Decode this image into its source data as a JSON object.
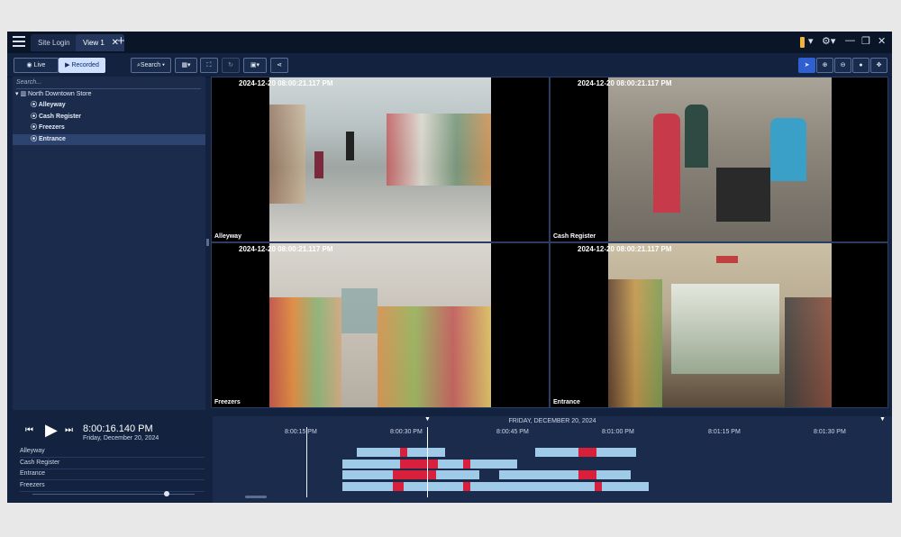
{
  "titlebar": {
    "tabs": [
      "Site Login",
      "View 1"
    ],
    "new_tab": "+"
  },
  "toolbar": {
    "live_label": "Live",
    "recorded_label": "Recorded",
    "search_label": "Search",
    "search_caret": "▾"
  },
  "sidebar": {
    "search_placeholder": "Search...",
    "root": "North Downtown Store",
    "items": [
      "Alleyway",
      "Cash Register",
      "Freezers",
      "Entrance"
    ],
    "selected_index": 3
  },
  "videos": [
    {
      "timestamp": "2024-12-20 08:00:21.117 PM",
      "name": "Alleyway"
    },
    {
      "timestamp": "2024-12-20 08:00:21.117 PM",
      "name": "Cash Register"
    },
    {
      "timestamp": "2024-12-20 08:00:21.117 PM",
      "name": "Freezers"
    },
    {
      "timestamp": "2024-12-20 08:00:21.117 PM",
      "name": "Entrance"
    }
  ],
  "playback": {
    "time": "8:00:16.140 PM",
    "date": "Friday, December 20, 2024",
    "cameras": [
      "Alleyway",
      "Cash Register",
      "Entrance",
      "Freezers"
    ]
  },
  "timeline": {
    "date_label": "FRIDAY, DECEMBER 20, 2024",
    "ticks": [
      "8:00:15 PM",
      "8:00:30 PM",
      "8:00:45 PM",
      "8:01:00 PM",
      "8:01:15 PM",
      "8:01:30 PM"
    ]
  },
  "colors": {
    "accent": "#2f5fd0",
    "recording_motion": "#d8203c",
    "recording": "#9fcbe8"
  }
}
